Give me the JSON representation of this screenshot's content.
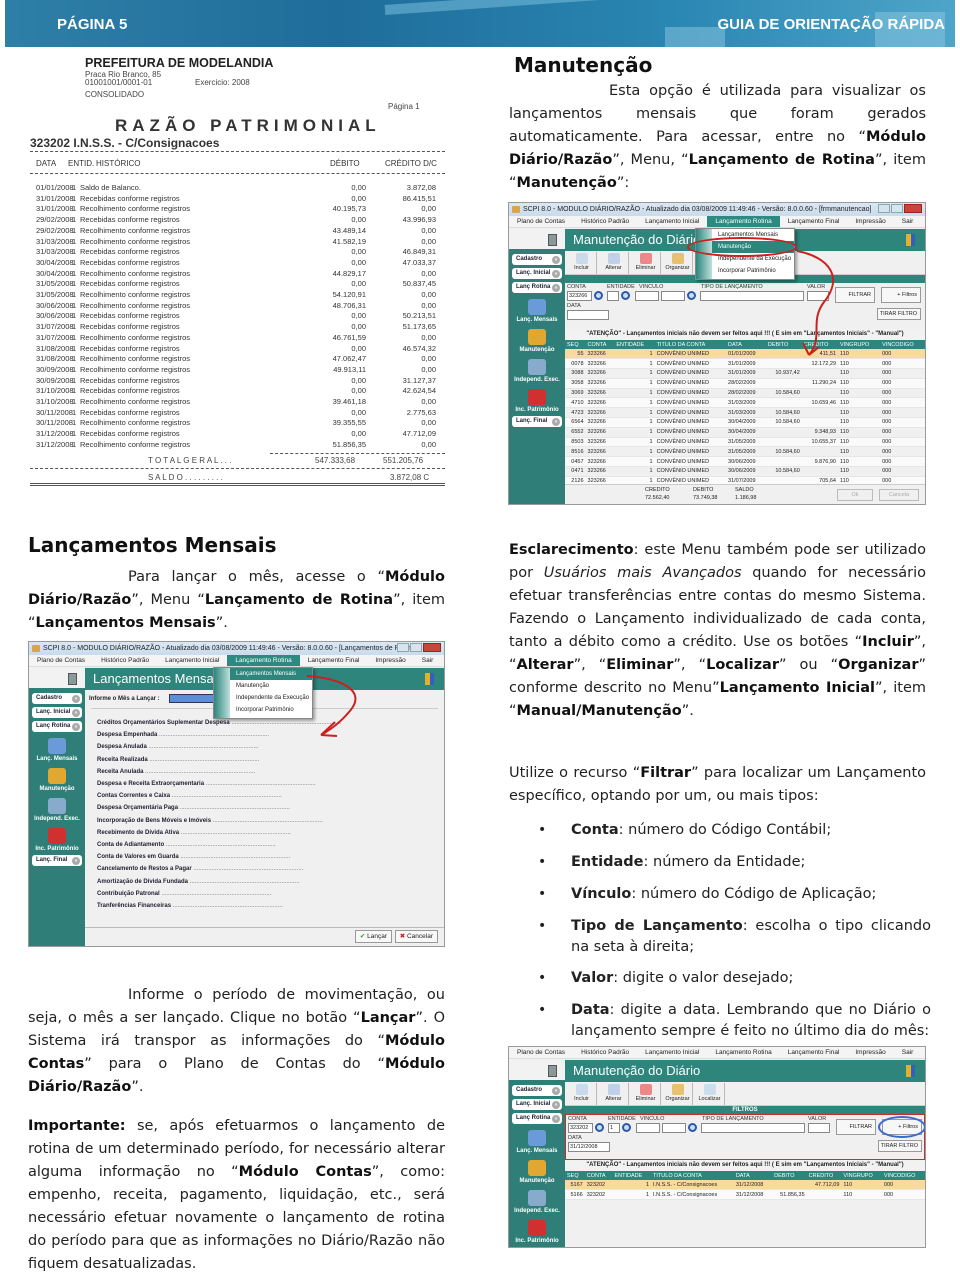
{
  "header": {
    "page_label": "PÁGINA 5",
    "guide_title": "GUIA DE ORIENTAÇÃO RÁPIDA"
  },
  "ledger": {
    "org_name": "PREFEITURA DE MODELANDIA",
    "address": "Praca Rio Branco, 85",
    "cnpj": "01001001/0001-01",
    "exercise": "Exercicio:  2008",
    "scope": "CONSOLIDADO",
    "page": "Página 1",
    "title": "RAZÃO PATRIMONIAL",
    "account": "323202    I.N.S.S. - C/Consignacoes",
    "columns": [
      "DATA",
      "ENTID.",
      "HISTÓRICO",
      "DÉBITO",
      "CRÉDITO D/C"
    ],
    "rows": [
      [
        "01/01/2008",
        "1",
        "Saldo de Balanco.",
        "0,00",
        "3.872,08"
      ],
      [
        "31/01/2008",
        "1",
        "Recebidas conforme registros",
        "0,00",
        "86.415,51"
      ],
      [
        "31/01/2008",
        "1",
        "Recolhimento conforme registros",
        "40.195,73",
        "0,00"
      ],
      [
        "29/02/2008",
        "1",
        "Recebidas conforme registros",
        "0,00",
        "43.996,93"
      ],
      [
        "29/02/2008",
        "1",
        "Recolhimento conforme registros",
        "43.489,14",
        "0,00"
      ],
      [
        "31/03/2008",
        "1",
        "Recolhimento conforme registros",
        "41.582,19",
        "0,00"
      ],
      [
        "31/03/2008",
        "1",
        "Recebidas conforme registros",
        "0,00",
        "46.849,31"
      ],
      [
        "30/04/2008",
        "1",
        "Recebidas conforme registros",
        "0,00",
        "47.033,37"
      ],
      [
        "30/04/2008",
        "1",
        "Recolhimento conforme registros",
        "44.829,17",
        "0,00"
      ],
      [
        "31/05/2008",
        "1",
        "Recebidas conforme registros",
        "0,00",
        "50.837,45"
      ],
      [
        "31/05/2008",
        "1",
        "Recolhimento conforme registros",
        "54.120,91",
        "0,00"
      ],
      [
        "30/06/2008",
        "1",
        "Recolhimento conforme registros",
        "48.706,31",
        "0,00"
      ],
      [
        "30/06/2008",
        "1",
        "Recebidas conforme registros",
        "0,00",
        "50.213,51"
      ],
      [
        "31/07/2008",
        "1",
        "Recebidas conforme registros",
        "0,00",
        "51.173,65"
      ],
      [
        "31/07/2008",
        "1",
        "Recolhimento conforme registros",
        "46.761,59",
        "0,00"
      ],
      [
        "31/08/2008",
        "1",
        "Recebidas conforme registros",
        "0,00",
        "46.574,32"
      ],
      [
        "31/08/2008",
        "1",
        "Recolhimento conforme registros",
        "47.062,47",
        "0,00"
      ],
      [
        "30/09/2008",
        "1",
        "Recolhimento conforme registros",
        "49.913,11",
        "0,00"
      ],
      [
        "30/09/2008",
        "1",
        "Recebidas conforme registros",
        "0,00",
        "31.127,37"
      ],
      [
        "31/10/2008",
        "1",
        "Recebidas conforme registros",
        "0,00",
        "42.624,54"
      ],
      [
        "31/10/2008",
        "1",
        "Recolhimento conforme registros",
        "39.461,18",
        "0,00"
      ],
      [
        "30/11/2008",
        "1",
        "Recebidas conforme registros",
        "0,00",
        "2.775,63"
      ],
      [
        "30/11/2008",
        "1",
        "Recolhimento conforme registros",
        "39.355,55",
        "0,00"
      ],
      [
        "31/12/2008",
        "1",
        "Recebidas conforme registros",
        "0,00",
        "47.712,09"
      ],
      [
        "31/12/2008",
        "1",
        "Recolhimento conforme registros",
        "51.856,35",
        "0,00"
      ]
    ],
    "total_label": "T O T A L   G E R A L . . .",
    "total_debit": "547.333,68",
    "total_credit": "551.205,76",
    "saldo_label": "S A L D O . . . . . . . . .",
    "saldo_value": "3.872,08  C"
  },
  "manutencao": {
    "heading": "Manutenção",
    "p1": "Esta opção é utilizada para visualizar os lançamentos mensais que foram gerados automaticamente. Para acessar, entre no “",
    "b1": "Módulo Diário/Razão",
    "p2": "”, Menu, “",
    "b2": "Lançamento de Rotina",
    "p3": "”, item “",
    "b3": "Manutenção",
    "p4": "”:"
  },
  "app_common": {
    "menu": [
      "Plano de Contas",
      "Histórico Padrão",
      "Lançamento Inicial",
      "Lançamento Rotina",
      "Lançamento Final",
      "Impressão",
      "Sair",
      "?"
    ],
    "sidebar_groups": [
      "Cadastro",
      "Lanç. Inicial",
      "Lanç Rotina",
      "Lanç. Final"
    ],
    "sidebar_items": [
      "Lanç. Mensais",
      "Manutenção",
      "Independ. Exec.",
      "Inc. Patrimônio"
    ],
    "toolbar": [
      "Incluir",
      "Alterar",
      "Eliminar",
      "Organizar",
      "Localizar"
    ],
    "filters_title": "FILTROS",
    "filter_labels": {
      "conta": "CONTA",
      "entidade": "ENTIDADE",
      "vinculo": "VINCULO",
      "tipo": "TIPO DE LANÇAMENTO",
      "valor": "VALOR",
      "data": "DATA"
    },
    "filter_buttons": {
      "filtrar": "FILTRAR",
      "mais_filtros": "+ Filtros",
      "tirar": "TIRAR FILTRO"
    },
    "warning": "\"ATENÇÃO\" - Lançamentos iniciais não devem ser feitos aqui !!! ( E sim em \"Lançamentos Iniciais\" - \"Manual\")",
    "grid_columns": [
      "SEQ",
      "CONTA",
      "ENTIDADE",
      "TITULO DA CONTA",
      "DATA",
      "DEBITO",
      "CREDITO",
      "VINGRUPO",
      "VINCODIGO"
    ],
    "popup_items": [
      "Lançamentos Mensais",
      "Manutenção",
      "Independente da Execução",
      "Incorporar Patrimônio"
    ]
  },
  "app1": {
    "title": "SCPI 8.0 - MODULO DIÁRIO/RAZÃO - Atualizado dia 03/08/2009 11:49:46 - Versão: 8.0.0.60 - [frmmanutencao]",
    "banner": "Manutenção do Diário",
    "conta_value": "323266",
    "rows": [
      [
        "55",
        "323266",
        "1",
        "CONVÊNIO UNIMED",
        "01/01/2009",
        "",
        "411,51",
        "110",
        "000"
      ],
      [
        "0078",
        "323266",
        "1",
        "CONVÊNIO UNIMED",
        "31/01/2009",
        "",
        "12.172,29",
        "110",
        "000"
      ],
      [
        "3088",
        "323266",
        "1",
        "CONVÊNIO UNIMED",
        "31/01/2009",
        "10.937,42",
        "",
        "110",
        "000"
      ],
      [
        "3058",
        "323266",
        "1",
        "CONVÊNIO UNIMED",
        "28/02/2009",
        "",
        "11.290,24",
        "110",
        "000"
      ],
      [
        "3069",
        "323266",
        "1",
        "CONVÊNIO UNIMED",
        "28/02/2009",
        "10.584,60",
        "",
        "110",
        "000"
      ],
      [
        "4710",
        "323266",
        "1",
        "CONVÊNIO UNIMED",
        "31/03/2009",
        "",
        "10.659,46",
        "110",
        "000"
      ],
      [
        "4723",
        "323266",
        "1",
        "CONVÊNIO UNIMED",
        "31/03/2009",
        "10.584,60",
        "",
        "110",
        "000"
      ],
      [
        "6564",
        "323266",
        "1",
        "CONVÊNIO UNIMED",
        "30/04/2009",
        "10.584,60",
        "",
        "110",
        "000"
      ],
      [
        "6552",
        "323266",
        "1",
        "CONVÊNIO UNIMED",
        "30/04/2009",
        "",
        "9.348,93",
        "110",
        "000"
      ],
      [
        "8503",
        "323266",
        "1",
        "CONVÊNIO UNIMED",
        "31/05/2009",
        "",
        "10.655,37",
        "110",
        "000"
      ],
      [
        "8516",
        "323266",
        "1",
        "CONVÊNIO UNIMED",
        "31/05/2009",
        "10.584,60",
        "",
        "110",
        "000"
      ],
      [
        "0457",
        "323266",
        "1",
        "CONVÊNIO UNIMED",
        "30/06/2009",
        "",
        "9.876,90",
        "110",
        "000"
      ],
      [
        "0471",
        "323266",
        "1",
        "CONVÊNIO UNIMED",
        "30/06/2009",
        "10.584,60",
        "",
        "110",
        "000"
      ],
      [
        "2126",
        "323266",
        "1",
        "CONVÊNIO UNIMED",
        "31/07/2009",
        "",
        "705,64",
        "110",
        "000"
      ]
    ],
    "totals": {
      "credito_label": "CREDITO",
      "credito": "72.562,40",
      "debito_label": "DEBITO",
      "debito": "73.749,38",
      "saldo_label": "SALDO",
      "saldo": "1.186,98"
    },
    "ok_label": "Ok",
    "cancel_label": "Cancela"
  },
  "lanc_mensais": {
    "heading": "Lançamentos Mensais",
    "p1": "Para lançar o mês, acesse o “",
    "b1": "Módulo Diário/Razão",
    "p2": "”, Menu “",
    "b2": "Lançamento de Rotina",
    "p3": "”, item “",
    "b3": "Lançamentos Mensais",
    "p4": "”."
  },
  "app2": {
    "title": "SCPI 8.0 - MODULO DIÁRIO/RAZÃO - Atualizado dia 03/08/2009 11:49:46 - Versão: 8.0.0.60 - [Lançamentos de Rotina..]",
    "banner": "Lançamentos Mensais",
    "month_label": "Informe o Mês a Lançar :",
    "items": [
      "Créditos Orçamentários Suplementar Despesa",
      "Despesa Empenhada",
      "Despesa Anulada",
      "Receita Realizada",
      "Receita Anulada",
      "Despesa e Receita Extraorçamentaria",
      "Contas Correntes e Caixa",
      "Despesa Orçamentária Paga",
      "Incorporação de Bens Móveis e Imóveis",
      "Recebimento de Dívida Ativa",
      "Conta de Adiantamento",
      "Conta de Valores em Guarda",
      "Cancelamento de Restos a Pagar",
      "Amortização de Dívida Fundada",
      "Contribuição Patronal",
      "Tranferências Financeiras"
    ],
    "lancar_label": "Lançar",
    "cancelar_label": "Cancelar"
  },
  "informe": {
    "p1": "Informe o período de movimentação, ou seja, o mês a ser lançado. Clique no botão “",
    "b1": "Lançar",
    "p2": "”. O Sistema irá transpor as informações do “",
    "b2": "Módulo Contas",
    "p3": "” para o Plano de Contas do “",
    "b3": "Módulo Diário/Razão",
    "p4": "”."
  },
  "importante": {
    "b1": "Importante:",
    "p1": " se, após efetuarmos o lançamento de rotina de um determinado período, for necessário alterar alguma informação no “",
    "b2": "Módulo Contas",
    "p2": "”, como: empenho, receita, pagamento, liquidação, etc., será necessário efetuar novamente o lançamento de  rotina do período para que as informações no Diário/Razão não fiquem desatualizadas."
  },
  "esclarecimento": {
    "b1": "Esclarecimento",
    "p1": ": este Menu também pode ser utilizado por ",
    "i1": "Usuários mais Avançados",
    "p2": " quando for necessário efetuar transferências entre contas do mesmo Sistema. Fazendo o Lançamento individualizado de cada conta, tanto a débito como a crédito. Use os botões “",
    "b2": "Incluir",
    "p3": "”, “",
    "b3": "Alterar",
    "p4": "”, “",
    "b4": "Eliminar",
    "p5": "”, “",
    "b5": "Localizar",
    "p6": "” ou “",
    "b6": "Organizar",
    "p7": "” conforme descrito no Menu”",
    "b7": "Lançamento Inicial",
    "p8": "”, item “",
    "b8": "Manual/Manutenção",
    "p9": "”."
  },
  "filtrar": {
    "p1": "Utilize o recurso “",
    "b1": "Filtrar",
    "p2": "” para localizar um Lançamento específico, optando por um, ou mais tipos:",
    "bullets": [
      {
        "term": "Conta",
        "desc": ": número do Código Contábil;"
      },
      {
        "term": "Entidade",
        "desc": ": número da Entidade;"
      },
      {
        "term": "Vínculo",
        "desc": ": número do Código de Aplicação;"
      },
      {
        "term": "Tipo de Lançamento",
        "desc": ": escolha o tipo clicando na seta à direita;"
      },
      {
        "term": "Valor",
        "desc": ": digite o valor desejado;"
      },
      {
        "term": "Data",
        "desc": ": digite a data. Lembrando que no Diário o lançamento sempre é feito no último dia do mês:"
      }
    ]
  },
  "app3": {
    "banner": "Manutenção do Diário",
    "conta_value": "323202",
    "entidade_value": "1",
    "data_value": "31/12/2008",
    "rows": [
      [
        "5167",
        "323202",
        "1",
        "I.N.S.S. - C/Consignacoes",
        "31/12/2008",
        "",
        "47.712,09",
        "110",
        "000"
      ],
      [
        "5166",
        "323202",
        "1",
        "I.N.S.S. - C/Consignacoes",
        "31/12/2008",
        "51.856,35",
        "",
        "110",
        "000"
      ]
    ]
  },
  "colors": {
    "teal": "#2d857c",
    "header_blue": "#2a7ca8",
    "highlight_row": "#f8d9a0",
    "annotation_red": "#cc2020",
    "annotation_blue": "#3a6ad0"
  }
}
